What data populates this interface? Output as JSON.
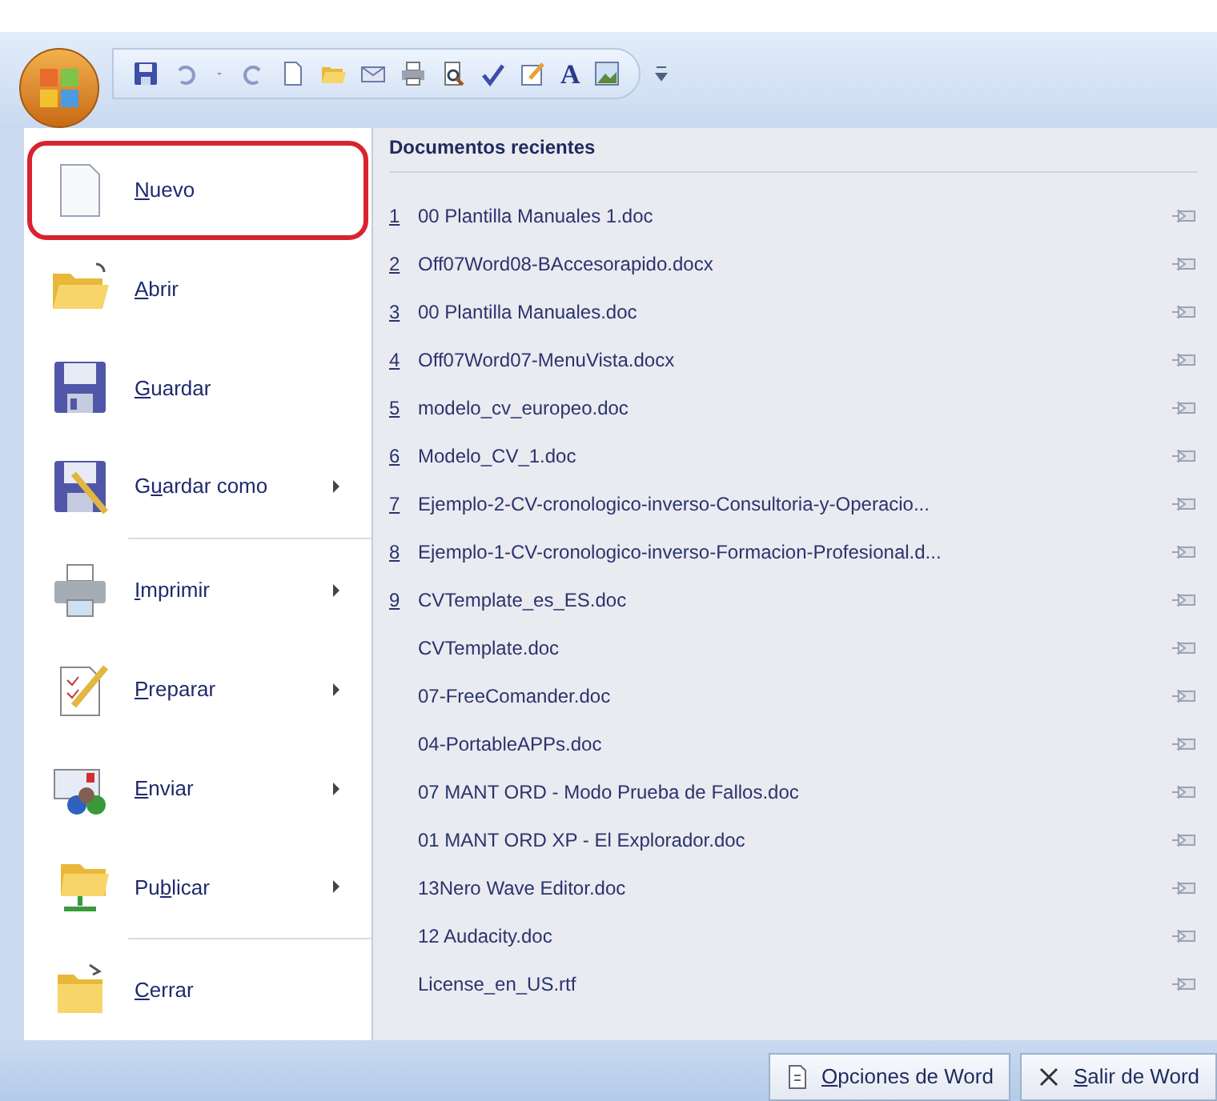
{
  "quick_access": {
    "letter": "A"
  },
  "menu": {
    "items": [
      {
        "key": "N",
        "post": "uevo",
        "submenu": false,
        "highlighted": true
      },
      {
        "key": "A",
        "post": "brir",
        "submenu": false,
        "highlighted": false
      },
      {
        "key": "G",
        "post": "uardar",
        "submenu": false,
        "highlighted": false
      },
      {
        "pre": "G",
        "key": "u",
        "post": "ardar como",
        "submenu": true,
        "highlighted": false
      },
      {
        "key": "I",
        "post": "mprimir",
        "submenu": true,
        "highlighted": false
      },
      {
        "key": "P",
        "post": "reparar",
        "submenu": true,
        "highlighted": false
      },
      {
        "key": "E",
        "post": "nviar",
        "submenu": true,
        "highlighted": false
      },
      {
        "pre": "Pu",
        "key": "b",
        "post": "licar",
        "submenu": true,
        "highlighted": false
      },
      {
        "key": "C",
        "post": "errar",
        "submenu": false,
        "highlighted": false
      }
    ]
  },
  "recent": {
    "title": "Documentos recientes",
    "documents": [
      {
        "number": "1",
        "name": "00 Plantilla Manuales 1.doc"
      },
      {
        "number": "2",
        "name": "Off07Word08-BAccesorapido.docx"
      },
      {
        "number": "3",
        "name": "00 Plantilla Manuales.doc"
      },
      {
        "number": "4",
        "name": "Off07Word07-MenuVista.docx"
      },
      {
        "number": "5",
        "name": "modelo_cv_europeo.doc"
      },
      {
        "number": "6",
        "name": "Modelo_CV_1.doc"
      },
      {
        "number": "7",
        "name": "Ejemplo-2-CV-cronologico-inverso-Consultoria-y-Operacio..."
      },
      {
        "number": "8",
        "name": "Ejemplo-1-CV-cronologico-inverso-Formacion-Profesional.d..."
      },
      {
        "number": "9",
        "name": "CVTemplate_es_ES.doc"
      },
      {
        "name": "CVTemplate.doc"
      },
      {
        "name": "07-FreeComander.doc"
      },
      {
        "name": "04-PortableAPPs.doc"
      },
      {
        "name": "07 MANT ORD - Modo Prueba de Fallos.doc"
      },
      {
        "name": "01 MANT ORD XP - El Explorador.doc"
      },
      {
        "name": "13Nero Wave Editor.doc"
      },
      {
        "name": "12 Audacity.doc"
      },
      {
        "name": "License_en_US.rtf"
      }
    ]
  },
  "footer": {
    "buttons": [
      {
        "kind": "options",
        "key": "O",
        "post": "pciones de Word"
      },
      {
        "kind": "exit",
        "key": "S",
        "post": "alir de Word"
      }
    ]
  }
}
